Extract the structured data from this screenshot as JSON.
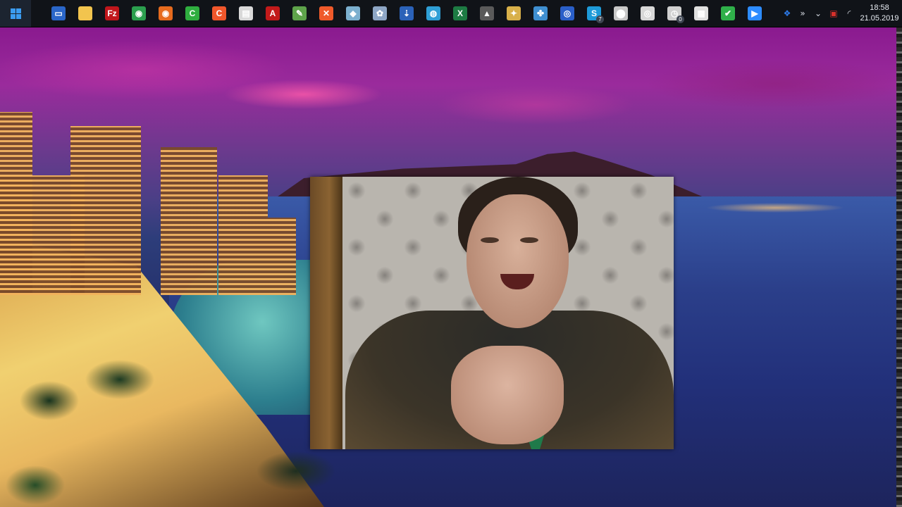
{
  "taskbar": {
    "start_button": "start-button",
    "apps": [
      {
        "name": "window-switcher-icon",
        "color": "#2a66c8",
        "glyph": "▭"
      },
      {
        "name": "file-explorer-icon",
        "color": "#f2c44e",
        "glyph": ""
      },
      {
        "name": "filezilla-icon",
        "color": "#c0161b",
        "glyph": "Fz"
      },
      {
        "name": "chrome-icon",
        "color": "#2b9f4e",
        "glyph": "◉"
      },
      {
        "name": "firefox-icon",
        "color": "#e66b1e",
        "glyph": "◉"
      },
      {
        "name": "green-c-app-icon",
        "color": "#2fae3f",
        "glyph": "C"
      },
      {
        "name": "orange-c-app-icon",
        "color": "#f0572b",
        "glyph": "C"
      },
      {
        "name": "presentation-icon",
        "color": "#d9d9d9",
        "glyph": "▤"
      },
      {
        "name": "adobe-acrobat-icon",
        "color": "#c21a1a",
        "glyph": "A"
      },
      {
        "name": "notepad-icon",
        "color": "#5ea34a",
        "glyph": "✎"
      },
      {
        "name": "xmind-icon",
        "color": "#ef5a2a",
        "glyph": "✕"
      },
      {
        "name": "eraser-icon",
        "color": "#7cb0cf",
        "glyph": "◆"
      },
      {
        "name": "paint-icon",
        "color": "#8ea6c5",
        "glyph": "✿"
      },
      {
        "name": "download-manager-icon",
        "color": "#2b62b8",
        "glyph": "⇣"
      },
      {
        "name": "world-globe-icon",
        "color": "#2f9fd6",
        "glyph": "◍"
      },
      {
        "name": "excel-icon",
        "color": "#1d7b43",
        "glyph": "X"
      },
      {
        "name": "wolf-app-icon",
        "color": "#5a5a5a",
        "glyph": "▲"
      },
      {
        "name": "tools-icon",
        "color": "#d8b04a",
        "glyph": "✦"
      },
      {
        "name": "network-app-icon",
        "color": "#3f8fd0",
        "glyph": "✤"
      },
      {
        "name": "blue-square-app-icon",
        "color": "#2a5fc8",
        "glyph": "◎"
      },
      {
        "name": "skype-icon",
        "color": "#1e9ad8",
        "glyph": "S",
        "badge": "7"
      },
      {
        "name": "microphone-icon",
        "color": "#c8c8c8",
        "glyph": "⬤"
      },
      {
        "name": "target-icon",
        "color": "#d8d8d8",
        "glyph": "◎"
      },
      {
        "name": "alarm-clock-icon",
        "color": "#d0d0d0",
        "glyph": "◷",
        "badge": "0"
      },
      {
        "name": "clapperboard-icon",
        "color": "#e0e0e0",
        "glyph": "▦"
      },
      {
        "name": "green-check-icon",
        "color": "#2fb04a",
        "glyph": "✔"
      },
      {
        "name": "zoom-icon",
        "color": "#2d8cff",
        "glyph": "▶"
      }
    ],
    "tray": [
      {
        "name": "dropbox-icon",
        "glyph": "❖",
        "color": "#2d7bea"
      },
      {
        "name": "overflow-chevrons-icon",
        "glyph": "»",
        "color": "#d6dbe3"
      },
      {
        "name": "show-hidden-icons-chevron-icon",
        "glyph": "⌄",
        "color": "#d6dbe3"
      },
      {
        "name": "red-app-tray-icon",
        "glyph": "▣",
        "color": "#d8302b"
      },
      {
        "name": "wifi-icon",
        "glyph": "◜",
        "color": "#d6dbe3"
      }
    ],
    "clock": {
      "time": "18:58",
      "date": "21.05.2019"
    }
  }
}
